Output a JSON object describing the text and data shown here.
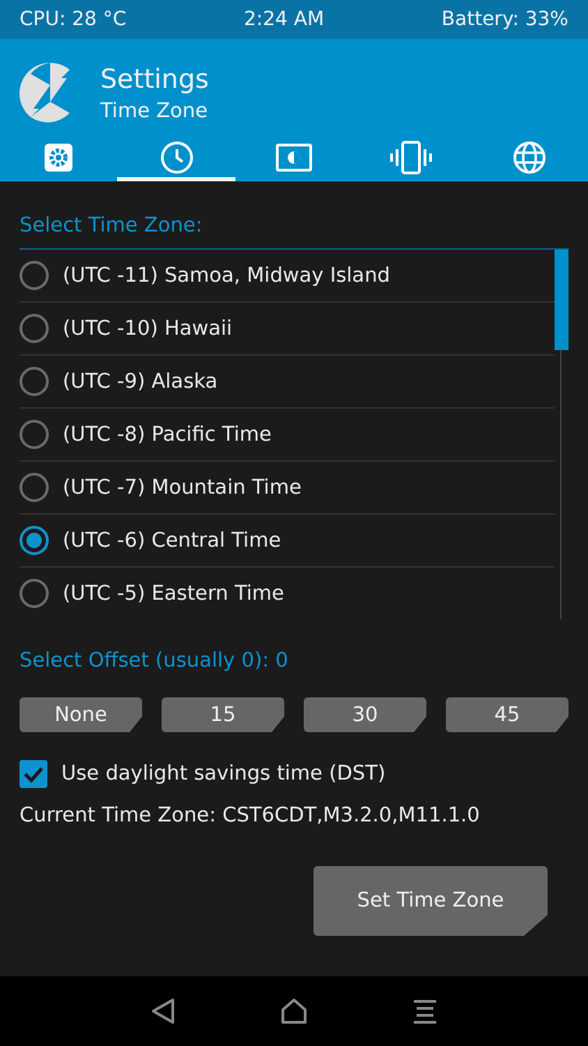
{
  "status_bar": {
    "cpu": "CPU: 28 °C",
    "time": "2:24 AM",
    "battery": "Battery: 33%"
  },
  "header": {
    "title": "Settings",
    "subtitle": "Time Zone"
  },
  "tabs": [
    {
      "kind": "settings",
      "selected": false
    },
    {
      "kind": "clock",
      "selected": true
    },
    {
      "kind": "screen",
      "selected": false
    },
    {
      "kind": "vibration",
      "selected": false
    },
    {
      "kind": "language",
      "selected": false
    }
  ],
  "time_zone_label": "Select Time Zone:",
  "time_zones": [
    {
      "label": "(UTC -11) Samoa, Midway Island",
      "selected": false
    },
    {
      "label": "(UTC -10) Hawaii",
      "selected": false
    },
    {
      "label": "(UTC -9) Alaska",
      "selected": false
    },
    {
      "label": "(UTC -8) Pacific Time",
      "selected": false
    },
    {
      "label": "(UTC -7) Mountain Time",
      "selected": false
    },
    {
      "label": "(UTC -6) Central Time",
      "selected": true
    },
    {
      "label": "(UTC -5) Eastern Time",
      "selected": false
    }
  ],
  "offset_label": "Select Offset (usually 0): 0",
  "offset_buttons": [
    "None",
    "15",
    "30",
    "45"
  ],
  "dst": {
    "label": "Use daylight savings time (DST)",
    "checked": true
  },
  "current_time_zone": "Current Time Zone: CST6CDT,M3.2.0,M11.1.0",
  "set_button": "Set Time Zone",
  "nav_bar": [
    {
      "kind": "back"
    },
    {
      "kind": "home"
    },
    {
      "kind": "menu"
    }
  ]
}
